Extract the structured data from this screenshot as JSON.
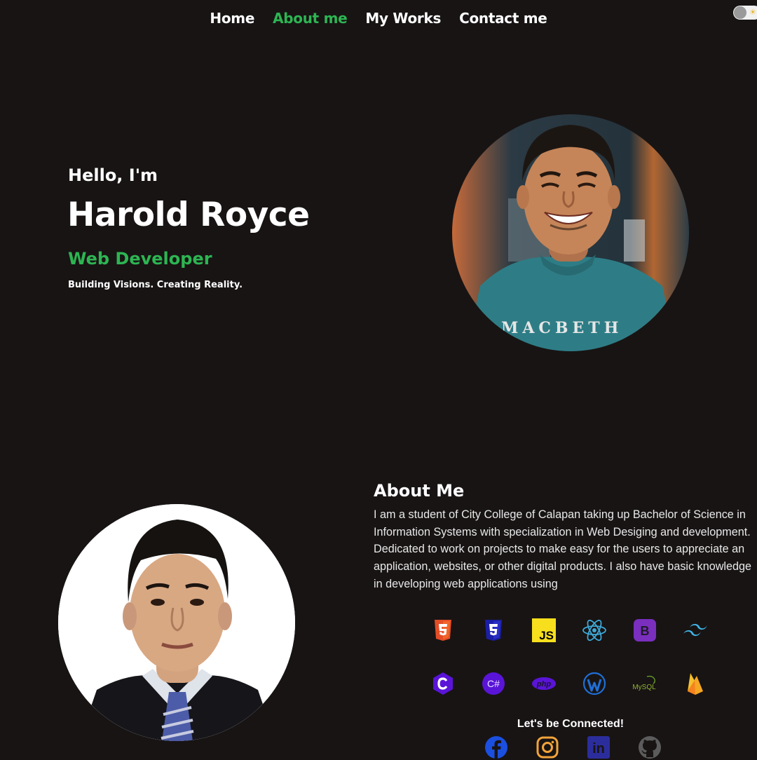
{
  "nav": {
    "items": [
      {
        "label": "Home",
        "active": false
      },
      {
        "label": "About me",
        "active": true
      },
      {
        "label": "My Works",
        "active": false
      },
      {
        "label": "Contact me",
        "active": false
      }
    ],
    "accent_color": "#2db552"
  },
  "theme_toggle": {
    "icon": "sun-icon",
    "state": "off"
  },
  "hero": {
    "greeting": "Hello, I'm",
    "name": "Harold Royce",
    "role": "Web Developer",
    "tagline": "Building Visions. Creating Reality.",
    "shirt_text": "MACBETH"
  },
  "about": {
    "title": "About Me",
    "text": "I am a student of City College of Calapan taking up Bachelor of Science in Information Systems with specialization in Web Desiging and development. Dedicated to work on projects to make easy for the users to appreciate an application, websites, or other digital products. I also have basic knowledge in developing web applications using",
    "tech_icons_row1": [
      "html5-icon",
      "css3-icon",
      "javascript-icon",
      "react-icon",
      "bootstrap-icon",
      "tailwind-icon"
    ],
    "tech_icons_row2": [
      "c-icon",
      "csharp-icon",
      "php-icon",
      "wordpress-icon",
      "mysql-icon",
      "firebase-icon"
    ],
    "tech_labels": {
      "js": "JS",
      "csharp": "C#",
      "php": "php",
      "mysql": "MySQL",
      "bootstrap": "B"
    }
  },
  "connect": {
    "label": "Let's be Connected!",
    "socials": [
      "facebook-icon",
      "instagram-icon",
      "linkedin-icon",
      "github-icon"
    ],
    "linkedin_text": "in"
  },
  "colors": {
    "background": "#181414",
    "accent": "#2db552",
    "text": "#ffffff"
  }
}
